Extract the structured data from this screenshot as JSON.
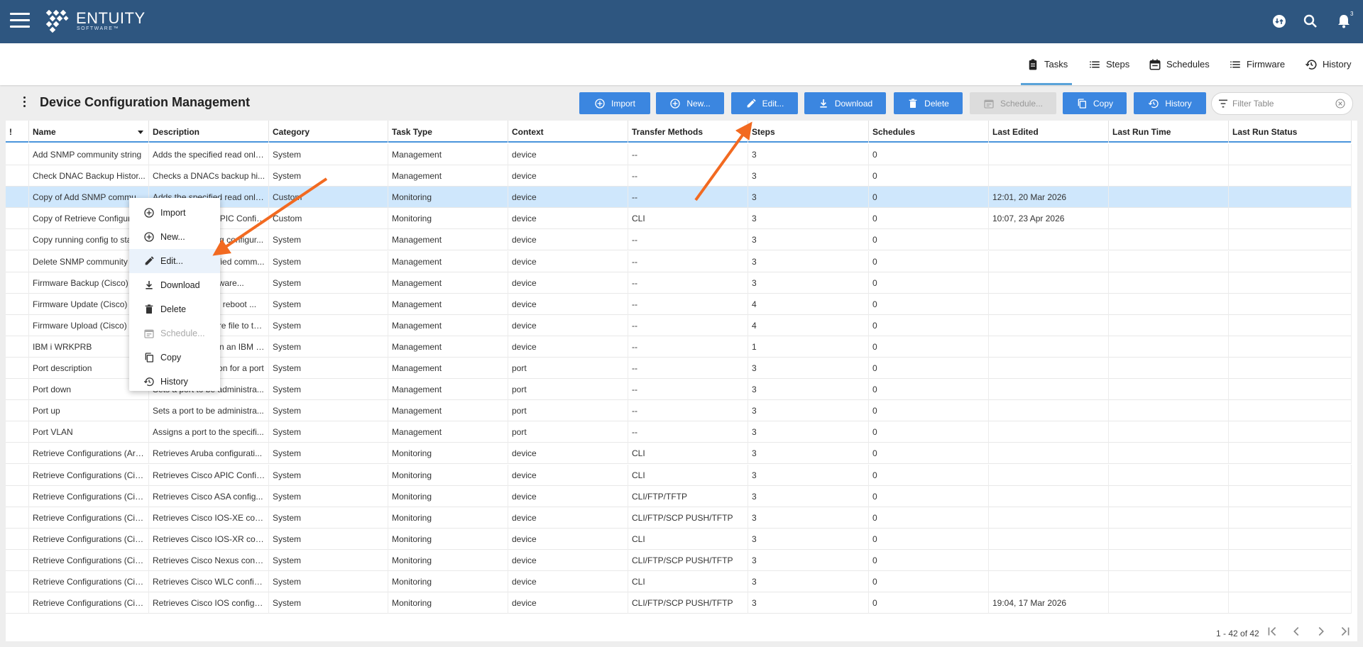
{
  "app": {
    "brand": "ENTUITY",
    "brand_sub": "SOFTWARE™",
    "notification_count": "3"
  },
  "nav": {
    "tabs": [
      {
        "label": "Tasks",
        "icon": "clipboard-icon",
        "active": true
      },
      {
        "label": "Steps",
        "icon": "list-icon"
      },
      {
        "label": "Schedules",
        "icon": "calendar-icon"
      },
      {
        "label": "Firmware",
        "icon": "list-icon"
      },
      {
        "label": "History",
        "icon": "history-icon"
      }
    ]
  },
  "page": {
    "title": "Device Configuration Management"
  },
  "toolbar": {
    "import": "Import",
    "new": "New...",
    "edit": "Edit...",
    "download": "Download",
    "delete": "Delete",
    "schedule": "Schedule...",
    "copy": "Copy",
    "history": "History",
    "filter_placeholder": "Filter Table"
  },
  "table": {
    "columns": [
      "!",
      "Name",
      "Description",
      "Category",
      "Task Type",
      "Context",
      "Transfer Methods",
      "Steps",
      "Schedules",
      "Last Edited",
      "Last Run Time",
      "Last Run Status"
    ],
    "rows": [
      [
        "",
        "Add SNMP community string",
        "Adds the specified read only...",
        "System",
        "Management",
        "device",
        "--",
        "3",
        "0",
        "",
        "",
        ""
      ],
      [
        "",
        "Check DNAC Backup Histor...",
        "Checks a DNACs backup hi...",
        "System",
        "Management",
        "device",
        "--",
        "3",
        "0",
        "",
        "",
        ""
      ],
      [
        "",
        "Copy of Add SNMP commu...",
        "Adds the specified read only...",
        "Custom",
        "Monitoring",
        "device",
        "--",
        "3",
        "0",
        "12:01, 20 Mar 2026",
        "",
        ""
      ],
      [
        "",
        "Copy of Retrieve Configura...",
        "Retrieves Cisco APIC Config...",
        "Custom",
        "Monitoring",
        "device",
        "CLI",
        "3",
        "0",
        "10:07, 23 Apr 2026",
        "",
        ""
      ],
      [
        "",
        "Copy running config to sta...",
        "Copies the running configur...",
        "System",
        "Management",
        "device",
        "--",
        "3",
        "0",
        "",
        "",
        ""
      ],
      [
        "",
        "Delete SNMP community s...",
        "Deletes the specified comm...",
        "System",
        "Management",
        "device",
        "--",
        "3",
        "0",
        "",
        "",
        ""
      ],
      [
        "",
        "Firmware Backup (Cisco)",
        "Backs up the firmware...",
        "System",
        "Management",
        "device",
        "--",
        "3",
        "0",
        "",
        "",
        ""
      ],
      [
        "",
        "Firmware Update (Cisco)",
        "Sets the device to reboot ...",
        "System",
        "Management",
        "device",
        "--",
        "4",
        "0",
        "",
        "",
        ""
      ],
      [
        "",
        "Firmware Upload (Cisco)",
        "Uploads a firmware file to the...",
        "System",
        "Management",
        "device",
        "--",
        "4",
        "0",
        "",
        "",
        ""
      ],
      [
        "",
        "IBM i WRKPRB",
        "Runs WRKPRB on an IBM i d...",
        "System",
        "Management",
        "device",
        "--",
        "1",
        "0",
        "",
        "",
        ""
      ],
      [
        "",
        "Port description",
        "Sets the description for a port",
        "System",
        "Management",
        "port",
        "--",
        "3",
        "0",
        "",
        "",
        ""
      ],
      [
        "",
        "Port down",
        "Sets a port to be administra...",
        "System",
        "Management",
        "port",
        "--",
        "3",
        "0",
        "",
        "",
        ""
      ],
      [
        "",
        "Port up",
        "Sets a port to be administra...",
        "System",
        "Management",
        "port",
        "--",
        "3",
        "0",
        "",
        "",
        ""
      ],
      [
        "",
        "Port VLAN",
        "Assigns a port to the specifi...",
        "System",
        "Management",
        "port",
        "--",
        "3",
        "0",
        "",
        "",
        ""
      ],
      [
        "",
        "Retrieve Configurations (Aru...",
        "Retrieves Aruba configurati...",
        "System",
        "Monitoring",
        "device",
        "CLI",
        "3",
        "0",
        "",
        "",
        ""
      ],
      [
        "",
        "Retrieve Configurations (Cis...",
        "Retrieves Cisco APIC Config...",
        "System",
        "Monitoring",
        "device",
        "CLI",
        "3",
        "0",
        "",
        "",
        ""
      ],
      [
        "",
        "Retrieve Configurations (Cis...",
        "Retrieves Cisco ASA config...",
        "System",
        "Monitoring",
        "device",
        "CLI/FTP/TFTP",
        "3",
        "0",
        "",
        "",
        ""
      ],
      [
        "",
        "Retrieve Configurations (Cis...",
        "Retrieves Cisco IOS-XE con...",
        "System",
        "Monitoring",
        "device",
        "CLI/FTP/SCP PUSH/TFTP",
        "3",
        "0",
        "",
        "",
        ""
      ],
      [
        "",
        "Retrieve Configurations (Cis...",
        "Retrieves Cisco IOS-XR con...",
        "System",
        "Monitoring",
        "device",
        "CLI",
        "3",
        "0",
        "",
        "",
        ""
      ],
      [
        "",
        "Retrieve Configurations (Cis...",
        "Retrieves Cisco Nexus confi...",
        "System",
        "Monitoring",
        "device",
        "CLI/FTP/SCP PUSH/TFTP",
        "3",
        "0",
        "",
        "",
        ""
      ],
      [
        "",
        "Retrieve Configurations (Cis...",
        "Retrieves Cisco WLC config...",
        "System",
        "Monitoring",
        "device",
        "CLI",
        "3",
        "0",
        "",
        "",
        ""
      ],
      [
        "",
        "Retrieve Configurations (Cis...",
        "Retrieves Cisco IOS configur...",
        "System",
        "Monitoring",
        "device",
        "CLI/FTP/SCP PUSH/TFTP",
        "3",
        "0",
        "19:04, 17 Mar 2026",
        "",
        ""
      ]
    ],
    "selected_row": 2
  },
  "pager": {
    "text": "1 - 42 of 42"
  },
  "context_menu": {
    "items": [
      {
        "label": "Import",
        "icon": "plus-circle-icon"
      },
      {
        "label": "New...",
        "icon": "plus-circle-icon"
      },
      {
        "label": "Edit...",
        "icon": "pencil-icon",
        "highlighted": true
      },
      {
        "label": "Download",
        "icon": "download-icon"
      },
      {
        "label": "Delete",
        "icon": "trash-icon"
      },
      {
        "label": "Schedule...",
        "icon": "calendar-icon",
        "disabled": true
      },
      {
        "label": "Copy",
        "icon": "copy-icon"
      },
      {
        "label": "History",
        "icon": "history-icon"
      }
    ]
  },
  "colors": {
    "topbar": "#2e5680",
    "button": "#3b86e0",
    "selected_row": "#cfe7fc",
    "annotation_arrow": "#f26a21"
  }
}
